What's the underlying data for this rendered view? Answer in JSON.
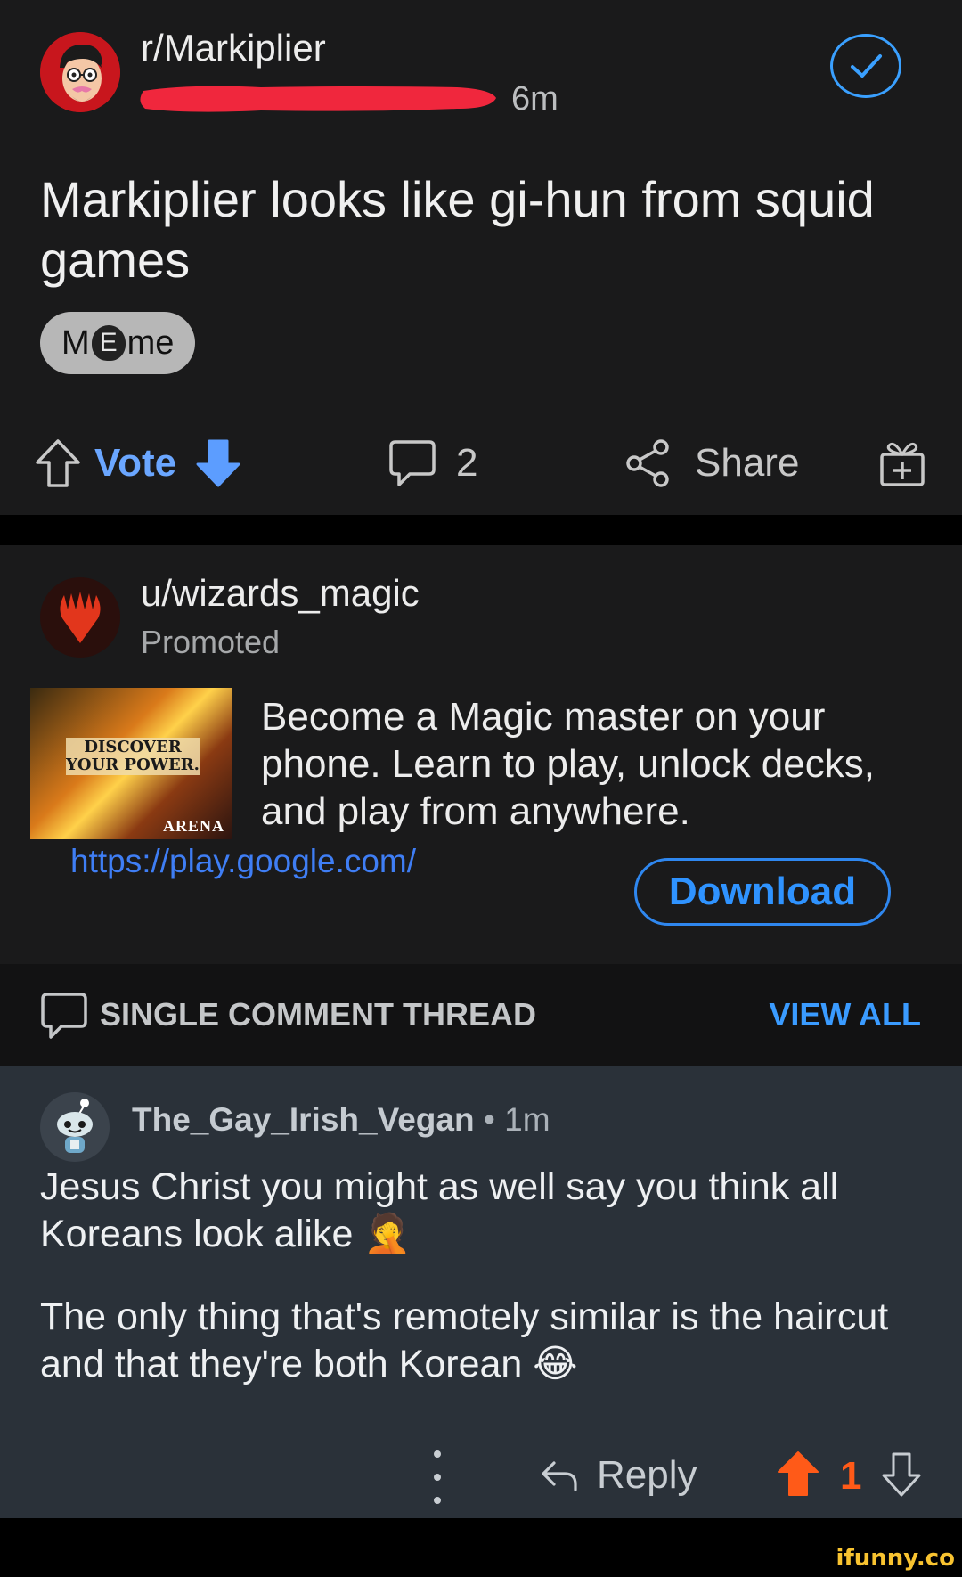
{
  "post": {
    "subreddit": "r/Markiplier",
    "time": "6m",
    "title": "Markiplier looks like gi-hun from squid games",
    "flair_prefix": "M",
    "flair_mid": "E",
    "flair_suffix": "me",
    "vote_label": "Vote",
    "comment_count": "2",
    "share_label": "Share"
  },
  "ad": {
    "user": "u/wizards_magic",
    "promoted": "Promoted",
    "thumb_line1": "DISCOVER",
    "thumb_line2": "YOUR POWER.",
    "thumb_brand": "ARENA",
    "body": "Become a Magic master on your phone. Learn to play, unlock decks, and play from anywhere.",
    "link": "https://play.google.com/",
    "button": "Download"
  },
  "thread": {
    "label": "SINGLE COMMENT THREAD",
    "view_all": "VIEW ALL"
  },
  "comment": {
    "author": "The_Gay_Irish_Vegan",
    "separator": "•",
    "time": "1m",
    "paragraph1": "Jesus Christ you might as well say you think all Koreans look alike 🤦",
    "paragraph2": "The only thing that's remotely similar is the haircut and that they're both Korean 😂",
    "reply_label": "Reply",
    "score": "1"
  },
  "watermark": "ifunny.co",
  "colors": {
    "accent_blue": "#3a9bff",
    "upvote_orange": "#ff5a18",
    "redaction_red": "#f0273d"
  }
}
